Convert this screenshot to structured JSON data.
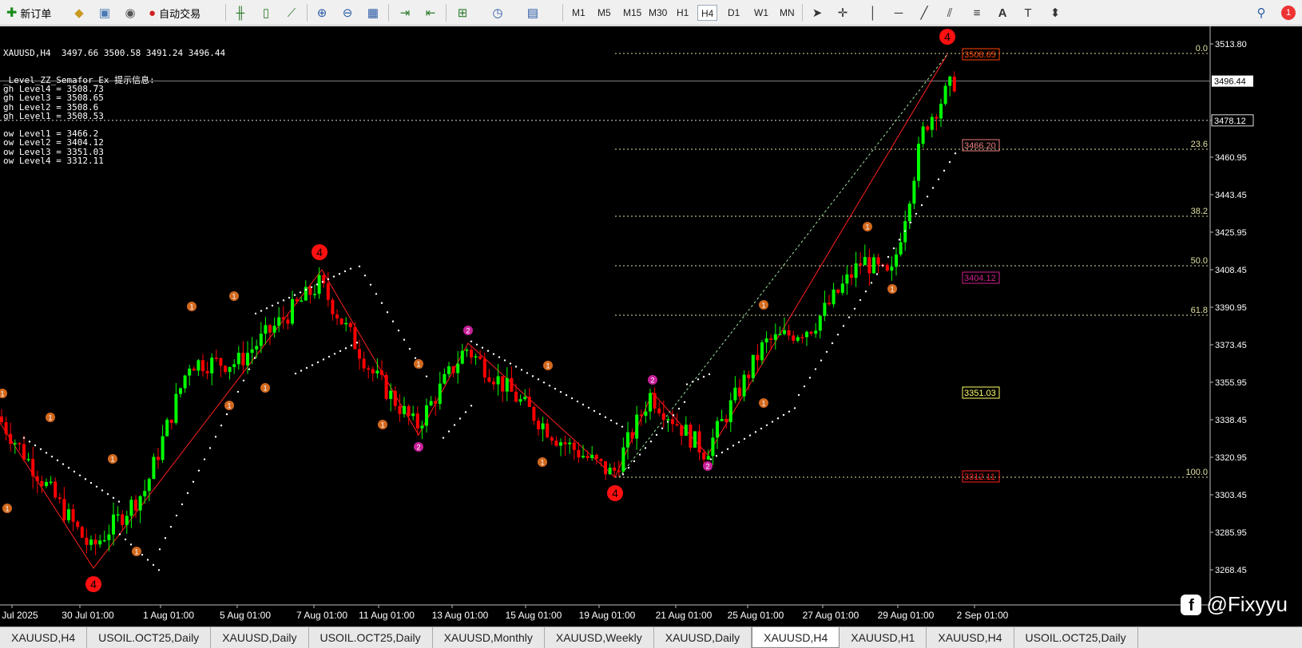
{
  "toolbar": {
    "new_order": "新订单",
    "auto_trading": "自动交易",
    "timeframes": [
      "M1",
      "M5",
      "M15",
      "M30",
      "H1",
      "H4",
      "D1",
      "W1",
      "MN"
    ],
    "active_timeframe": "H4",
    "notification_count": "1"
  },
  "chart": {
    "header": "XAUUSD,H4  3497.66 3500.58 3491.24 3496.44",
    "indicator_lines": [
      "_Level_ZZ_Semafor_Ex 提示信息:",
      "gh Level4 = 3508.73",
      "gh Level3 = 3508.65",
      "gh Level2 = 3508.6",
      "gh Level1 = 3508.53",
      "",
      "ow Level1 = 3466.2",
      "ow Level2 = 3404.12",
      "ow Level3 = 3351.03",
      "ow Level4 = 3312.11"
    ],
    "price_ticks": [
      "3513.80",
      "3478.12",
      "3460.95",
      "3443.45",
      "3425.95",
      "3408.45",
      "3390.95",
      "3373.45",
      "3355.95",
      "3338.45",
      "3320.95",
      "3303.45",
      "3285.95",
      "3268.45"
    ],
    "current_price": "3496.44",
    "time_labels": [
      "Jul 2025",
      "30 Jul 01:00",
      "1 Aug 01:00",
      "5 Aug 01:00",
      "7 Aug 01:00",
      "11 Aug 01:00",
      "13 Aug 01:00",
      "15 Aug 01:00",
      "19 Aug 01:00",
      "21 Aug 01:00",
      "25 Aug 01:00",
      "27 Aug 01:00",
      "29 Aug 01:00",
      "2 Sep 01:00"
    ],
    "fib_labels": [
      "0.0",
      "23.6",
      "38.2",
      "50.0",
      "61.8",
      "100.0"
    ],
    "level_labels": [
      {
        "text": "3508.65",
        "color": "#ff4500"
      },
      {
        "text": "3466.20",
        "color": "#f08080"
      },
      {
        "text": "3404.12",
        "color": "#d02090"
      },
      {
        "text": "3351.03",
        "color": "#ffff66"
      },
      {
        "text": "3312.11",
        "color": "#ff2020"
      }
    ],
    "up_color": "#00ff00",
    "down_color": "#ff0000",
    "watermark": "@Fixyyu"
  },
  "tabs": [
    "XAUUSD,H4",
    "USOIL.OCT25,Daily",
    "XAUUSD,Daily",
    "USOIL.OCT25,Daily",
    "XAUUSD,Monthly",
    "XAUUSD,Weekly",
    "XAUUSD,Daily",
    "XAUUSD,H4",
    "XAUUSD,H1",
    "XAUUSD,H4",
    "USOIL.OCT25,Daily"
  ],
  "active_tab": "XAUUSD,H4"
}
